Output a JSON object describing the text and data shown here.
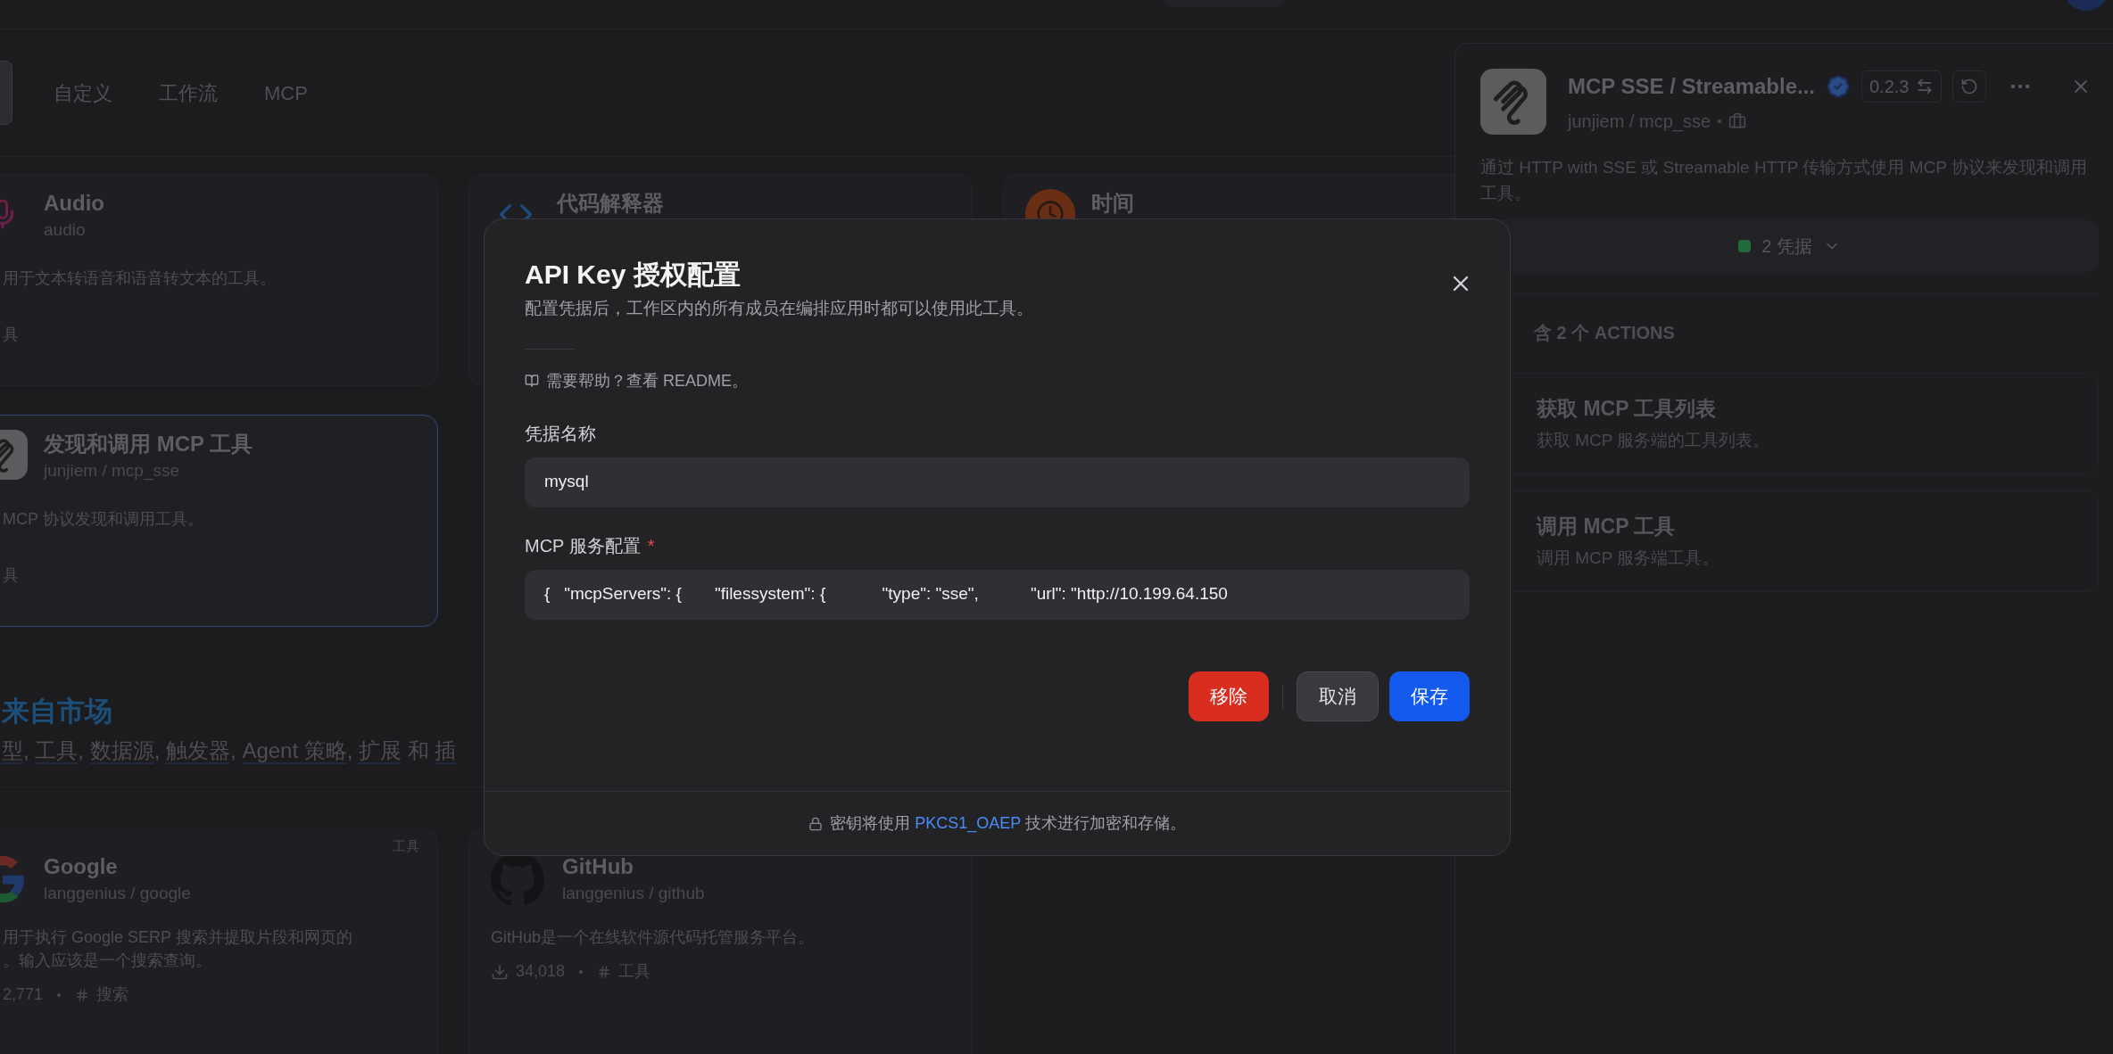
{
  "tabs": [
    {
      "label": "自定义"
    },
    {
      "label": "工作流"
    },
    {
      "label": "MCP"
    }
  ],
  "tool_cards": [
    {
      "name": "Audio",
      "handle": "audio",
      "description": "用于文本转语音和语音转文本的工具。",
      "tag": "具",
      "selected": false
    },
    {
      "name": "代码解释器",
      "selected": false
    },
    {
      "name": "时间",
      "selected": false
    },
    {
      "name": "发现和调用 MCP 工具",
      "handle": "junjiem / mcp_sse",
      "description": "MCP 协议发现和调用工具。",
      "tag": "具",
      "selected": true
    }
  ],
  "marketplace": {
    "heading": "来自市场",
    "line": [
      {
        "text": "型",
        "underlined": true
      },
      {
        "text": ", ",
        "underlined": false
      },
      {
        "text": "工具",
        "underlined": true
      },
      {
        "text": ", ",
        "underlined": false
      },
      {
        "text": "数据源",
        "underlined": true
      },
      {
        "text": ", ",
        "underlined": false
      },
      {
        "text": "触发器",
        "underlined": true
      },
      {
        "text": ", ",
        "underlined": false
      },
      {
        "text": "Agent 策略",
        "underlined": true
      },
      {
        "text": ", ",
        "underlined": false
      },
      {
        "text": "扩展",
        "underlined": true
      },
      {
        "text": " 和 ",
        "underlined": false
      },
      {
        "text": "插",
        "underlined": true
      }
    ],
    "cards": [
      {
        "tag": "工具",
        "name": "Google",
        "handle": "langgenius / google",
        "description": [
          "用于执行 Google SERP 搜索并提取片段和网页的",
          "。输入应该是一个搜索查询。"
        ],
        "installs": "2,771",
        "category": "搜索"
      },
      {
        "name": "GitHub",
        "handle": "langgenius / github",
        "description": [
          "GitHub是一个在线软件源代码托管服务平台。"
        ],
        "installs": "34,018",
        "category": "工具"
      }
    ]
  },
  "plugin_panel": {
    "title": "MCP SSE / Streamable...",
    "verified": true,
    "version": "0.2.3",
    "handle": "junjiem / mcp_sse",
    "description": "通过 HTTP with SSE 或 Streamable HTTP 传输方式使用 MCP 协议来发现和调用工具。",
    "credentials": {
      "label": "2 凭据",
      "color": "#1f6b3a"
    },
    "actions_heading": "含 2 个 ACTIONS",
    "actions": [
      {
        "title": "获取 MCP 工具列表",
        "description": "获取 MCP 服务端的工具列表。"
      },
      {
        "title": "调用 MCP 工具",
        "description": "调用 MCP 服务端工具。"
      }
    ]
  },
  "dialog": {
    "title": "API Key 授权配置",
    "subtitle": "配置凭据后，工作区内的所有成员在编排应用时都可以使用此工具。",
    "help": "需要帮助？查看 README。",
    "fields": [
      {
        "label": "凭据名称",
        "value": "mysql"
      },
      {
        "label": "MCP 服务配置",
        "required_mark": "*",
        "value": "{   \"mcpServers\": {       \"filessystem\": {            \"type\": \"sse\",           \"url\": \"http://10.199.64.150"
      }
    ],
    "buttons": [
      {
        "label": "移除",
        "kind": "danger"
      },
      {
        "label": "取消",
        "kind": "secondary"
      },
      {
        "label": "保存",
        "kind": "primary"
      }
    ],
    "footer": {
      "before": "密钥将使用",
      "link": "PKCS1_OAEP",
      "after": "技术进行加密和存储。"
    }
  }
}
